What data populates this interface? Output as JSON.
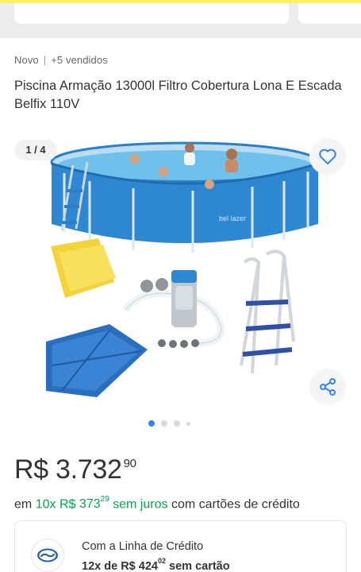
{
  "header": {
    "condition": "Novo",
    "separator": "|",
    "sold": "+5 vendidos"
  },
  "product": {
    "title": "Piscina Armação 13000l Filtro Cobertura Lona E Escada Belfix 110V"
  },
  "gallery": {
    "counter": "1 / 4",
    "current": 1,
    "total": 4,
    "pool_brand": "bel lazer"
  },
  "price": {
    "currency": "R$",
    "integer": "3.732",
    "cents": "90"
  },
  "installments": {
    "prefix": "em",
    "count": "10x",
    "currency": "R$",
    "value_integer": "373",
    "value_cents": "29",
    "no_interest": "sem juros",
    "suffix": "com cartões de crédito"
  },
  "credit_line": {
    "title": "Com a Linha de Crédito",
    "count": "12x de",
    "currency": "R$",
    "value_integer": "424",
    "value_cents": "02",
    "suffix": "sem cartão"
  },
  "colors": {
    "accent": "#3483fa",
    "green": "#00a650",
    "brand_yellow": "#fff159",
    "pool_blue": "#2e87d1"
  },
  "icons": {
    "favorite": "heart-icon",
    "share": "share-icon",
    "credit": "handshake-icon"
  }
}
